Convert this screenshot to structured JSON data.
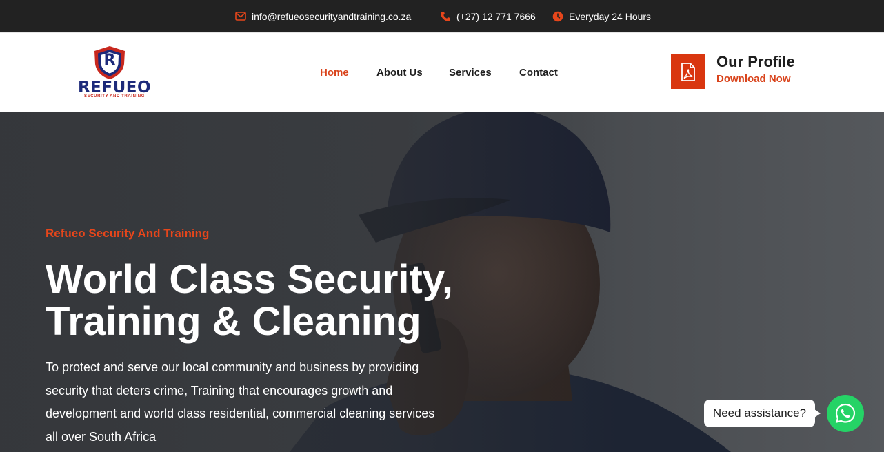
{
  "topbar": {
    "email": "info@refueosecurityandtraining.co.za",
    "phone": "(+27) 12 771 7666",
    "hours": "Everyday 24 Hours",
    "icons": [
      "envelope-icon",
      "phone-icon",
      "clock-icon"
    ],
    "icon_color": "#e6461b"
  },
  "logo": {
    "letter": "R",
    "wordmark": "REFUEO",
    "tagline": "SECURITY AND TRAINING"
  },
  "nav": {
    "items": [
      {
        "label": "Home",
        "active": true
      },
      {
        "label": "About Us",
        "active": false
      },
      {
        "label": "Services",
        "active": false
      },
      {
        "label": "Contact",
        "active": false
      }
    ]
  },
  "profile": {
    "title": "Our Profile",
    "subtitle": "Download Now",
    "icon": "pdf-file-icon"
  },
  "hero": {
    "eyebrow": "Refueo Security And Training",
    "title_line1": "World Class Security,",
    "title_line2": "Training & Cleaning",
    "description": "To protect and serve our local community and business by providing security that deters crime, Training that encourages growth and development and world class residential, commercial cleaning services all over South Africa"
  },
  "assistant": {
    "prompt": "Need assistance?",
    "icon": "whatsapp-icon"
  },
  "colors": {
    "accent": "#e6461b",
    "dark_bar": "#222222",
    "navy": "#1d2a7a",
    "whatsapp": "#25d366"
  }
}
